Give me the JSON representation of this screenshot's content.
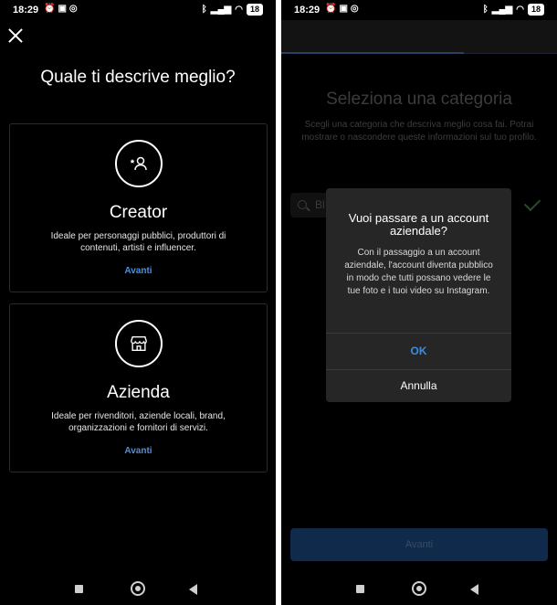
{
  "status": {
    "time": "18:29",
    "left_icons": [
      "alarm-icon",
      "calendar-icon",
      "instagram-icon"
    ],
    "right_icons": [
      "bluetooth-icon",
      "signal-icon",
      "wifi-icon"
    ],
    "battery": "18"
  },
  "left": {
    "title": "Quale ti descrive meglio?",
    "cards": [
      {
        "icon": "creator-icon",
        "title": "Creator",
        "description": "Ideale per personaggi pubblici, produttori di contenuti, artisti e influencer.",
        "link": "Avanti"
      },
      {
        "icon": "shop-icon",
        "title": "Azienda",
        "description": "Ideale per rivenditori, aziende locali, brand, organizzazioni e fornitori di servizi.",
        "link": "Avanti"
      }
    ]
  },
  "right": {
    "title": "Seleziona una categoria",
    "subtitle": "Scegli una categoria che descriva meglio cosa fai. Potrai mostrare o nascondere queste informazioni sul tuo profilo.",
    "search_value": "Bl",
    "button": "Avanti",
    "dialog": {
      "title": "Vuoi passare a un account aziendale?",
      "body": "Con il passaggio a un account aziendale, l'account diventa pubblico in modo che tutti possano vedere le tue foto e i tuoi video su Instagram.",
      "ok": "OK",
      "cancel": "Annulla"
    }
  }
}
